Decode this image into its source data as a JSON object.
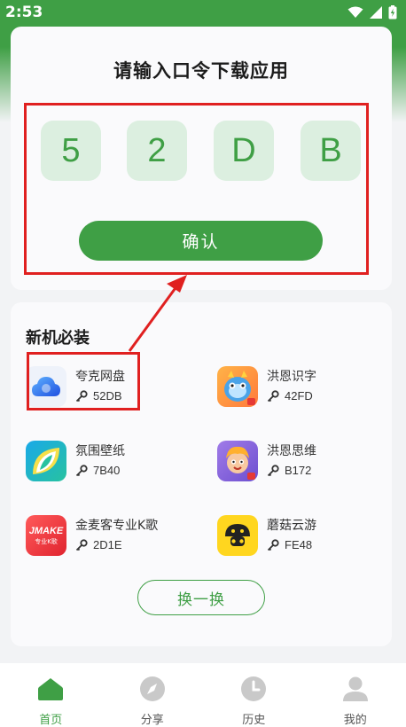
{
  "status_bar": {
    "time": "2:53"
  },
  "code_card": {
    "title": "请输入口令下载应用",
    "code": [
      "5",
      "2",
      "D",
      "B"
    ],
    "confirm_label": "确认"
  },
  "apps_section": {
    "heading": "新机必装",
    "apps": [
      {
        "name": "夸克网盘",
        "code": "52DB",
        "icon": "quark-cloud-icon"
      },
      {
        "name": "洪恩识字",
        "code": "42FD",
        "icon": "hongen-literacy-icon"
      },
      {
        "name": "氛围壁纸",
        "code": "7B40",
        "icon": "wallpaper-icon"
      },
      {
        "name": "洪恩思维",
        "code": "B172",
        "icon": "hongen-thinking-icon"
      },
      {
        "name": "金麦客专业K歌",
        "code": "2D1E",
        "icon": "jmake-karaoke-icon",
        "icon_text": "JMAKE",
        "icon_subtext": "专业K歌"
      },
      {
        "name": "蘑菇云游",
        "code": "FE48",
        "icon": "mushroom-game-icon"
      }
    ],
    "refresh_label": "换一换"
  },
  "bottom_nav": {
    "items": [
      {
        "label": "首页",
        "icon": "home-icon",
        "active": true
      },
      {
        "label": "分享",
        "icon": "compass-icon",
        "active": false
      },
      {
        "label": "历史",
        "icon": "clock-icon",
        "active": false
      },
      {
        "label": "我的",
        "icon": "user-icon",
        "active": false
      }
    ]
  },
  "colors": {
    "accent": "#3f9f45",
    "code_box_bg": "#dcefe0",
    "annotation_red": "#e02020"
  }
}
